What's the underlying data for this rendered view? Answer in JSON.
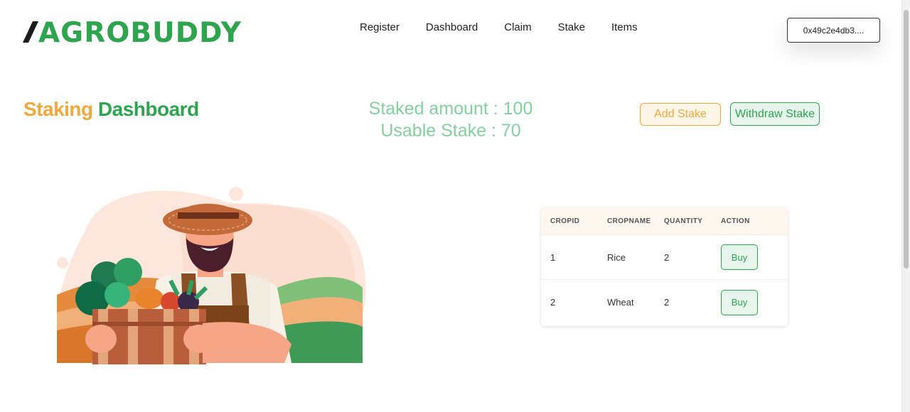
{
  "header": {
    "logo_text": "AGROBUDDY",
    "nav": [
      "Register",
      "Dashboard",
      "Claim",
      "Stake",
      "Items"
    ],
    "wallet": "0x49c2e4db3...."
  },
  "dashboard": {
    "title_word1": "Staking",
    "title_word2": "Dashboard",
    "staked_amount": "Staked amount : 100",
    "usable_stake": "Usable Stake : 70",
    "add_stake_label": "Add Stake",
    "withdraw_stake_label": "Withdraw Stake"
  },
  "table": {
    "headers": [
      "CROPID",
      "CROPNAME",
      "QUANTITY",
      "ACTION"
    ],
    "rows": [
      {
        "cropid": "1",
        "cropname": "Rice",
        "quantity": "2",
        "action": "Buy"
      },
      {
        "cropid": "2",
        "cropname": "Wheat",
        "quantity": "2",
        "action": "Buy"
      }
    ]
  },
  "colors": {
    "brand_green": "#2ea44f",
    "accent_orange": "#f0a93a",
    "light_green_text": "#86cfa1"
  }
}
